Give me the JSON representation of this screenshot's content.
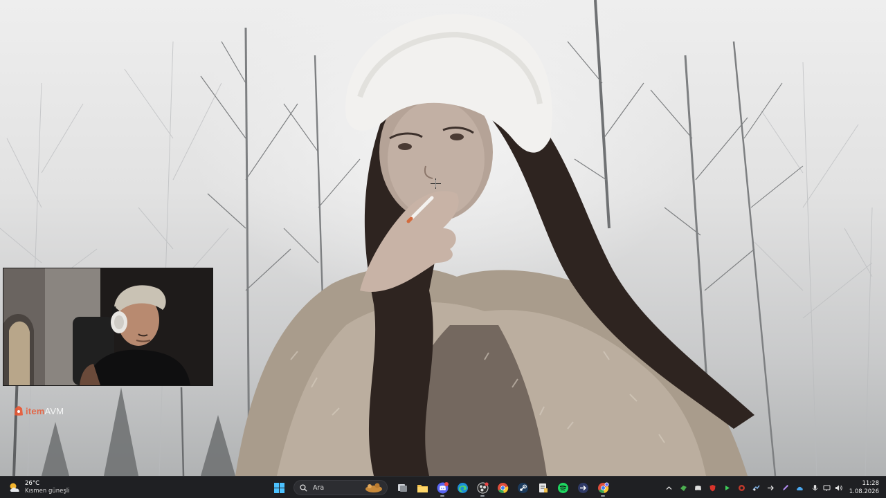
{
  "desktop": {
    "wallpaper_icon": "photo-wallpaper"
  },
  "webcam": {
    "icon": "webcam-overlay"
  },
  "sponsor": {
    "brand": "itemAVM",
    "name_accent": "item",
    "name_tail": "AVM",
    "accent_color": "#e95834"
  },
  "taskbar": {
    "background": "#1f2023",
    "weather": {
      "temperature": "26°C",
      "condition": "Kısmen güneşli",
      "icon": "partly-sunny-icon"
    },
    "start_icon": "windows-start-icon",
    "search": {
      "placeholder": "Ara",
      "icon": "search-icon"
    },
    "pinned": [
      {
        "name": "task-view",
        "icon": "task-view-icon"
      },
      {
        "name": "file-explorer",
        "icon": "folder-icon"
      },
      {
        "name": "discord",
        "icon": "discord-icon",
        "badge": "99+"
      },
      {
        "name": "edge",
        "icon": "edge-icon"
      },
      {
        "name": "obs",
        "icon": "obs-icon"
      },
      {
        "name": "chrome",
        "icon": "chrome-icon"
      },
      {
        "name": "steam",
        "icon": "steam-icon"
      },
      {
        "name": "notepad",
        "icon": "notepad-icon"
      },
      {
        "name": "spotify",
        "icon": "spotify-icon"
      },
      {
        "name": "vpn",
        "icon": "arrow-app-icon"
      },
      {
        "name": "chrome-profile",
        "icon": "chrome-profile-icon"
      }
    ],
    "tray": {
      "icons": [
        "show-hidden-icon",
        "app-green-icon",
        "discord-tray-icon",
        "shield-icon",
        "play-icon",
        "vpn-tray-icon",
        "steam-tray-icon",
        "arrow-tray-icon",
        "pen-tray-icon",
        "cloud-tray-icon",
        "mic-icon",
        "display-icon",
        "volume-icon"
      ]
    },
    "clock": {
      "time": "11:28",
      "date": "1.08.2026"
    }
  }
}
